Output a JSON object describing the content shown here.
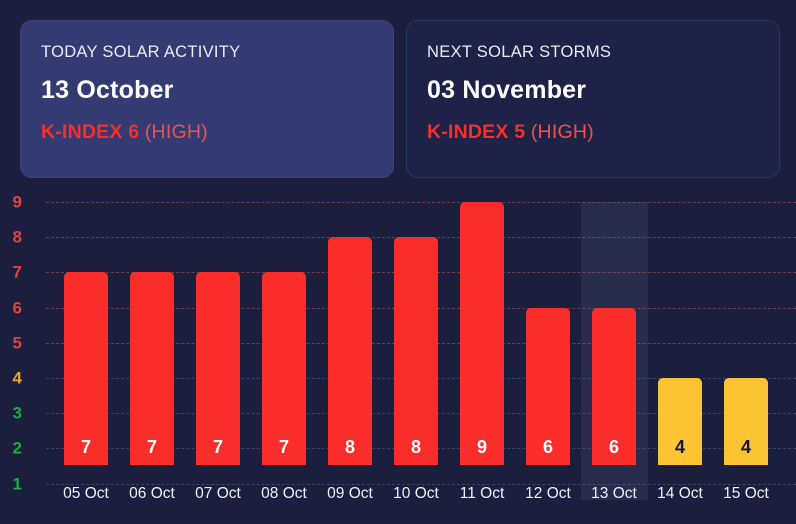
{
  "cards": [
    {
      "title": "TODAY SOLAR ACTIVITY",
      "date": "13 October",
      "kindex_label": "K-INDEX 6",
      "severity": "(HIGH)"
    },
    {
      "title": "NEXT SOLAR STORMS",
      "date": "03 November",
      "kindex_label": "K-INDEX 5",
      "severity": "(HIGH)"
    }
  ],
  "colors": {
    "background": "#1b1f3d",
    "card_today_bg": "#343b72",
    "card_next_bg": "#1d2246",
    "bar_red": "#fa2d2a",
    "bar_amber": "#fcc333",
    "kindex_red": "#f82e2a",
    "axis_red": "#e8403f",
    "axis_amber": "#e0a92e",
    "axis_green": "#21a84a",
    "highlight_band": "rgba(150,165,215,0.10)"
  },
  "chart_data": {
    "type": "bar",
    "title": "",
    "xlabel": "",
    "ylabel": "",
    "ylim": [
      1,
      9
    ],
    "grid": true,
    "legend": "none",
    "highlighted_category": "13 Oct",
    "categories": [
      "05 Oct",
      "06 Oct",
      "07 Oct",
      "08 Oct",
      "09 Oct",
      "10 Oct",
      "11 Oct",
      "12 Oct",
      "13 Oct",
      "14 Oct",
      "15 Oct"
    ],
    "values": [
      7,
      7,
      7,
      7,
      8,
      8,
      9,
      6,
      6,
      4,
      4
    ],
    "bar_colors": [
      "#fa2d2a",
      "#fa2d2a",
      "#fa2d2a",
      "#fa2d2a",
      "#fa2d2a",
      "#fa2d2a",
      "#fa2d2a",
      "#fa2d2a",
      "#fa2d2a",
      "#fcc333",
      "#fcc333"
    ],
    "y_ticks": [
      {
        "label": "9",
        "color": "#e8403f"
      },
      {
        "label": "8",
        "color": "#e8403f"
      },
      {
        "label": "7",
        "color": "#e8403f"
      },
      {
        "label": "6",
        "color": "#e8403f"
      },
      {
        "label": "5",
        "color": "#e03f3f"
      },
      {
        "label": "4",
        "color": "#e0a92e"
      },
      {
        "label": "3",
        "color": "#21a84a"
      },
      {
        "label": "2",
        "color": "#21a84a"
      },
      {
        "label": "1",
        "color": "#21a84a"
      }
    ]
  }
}
